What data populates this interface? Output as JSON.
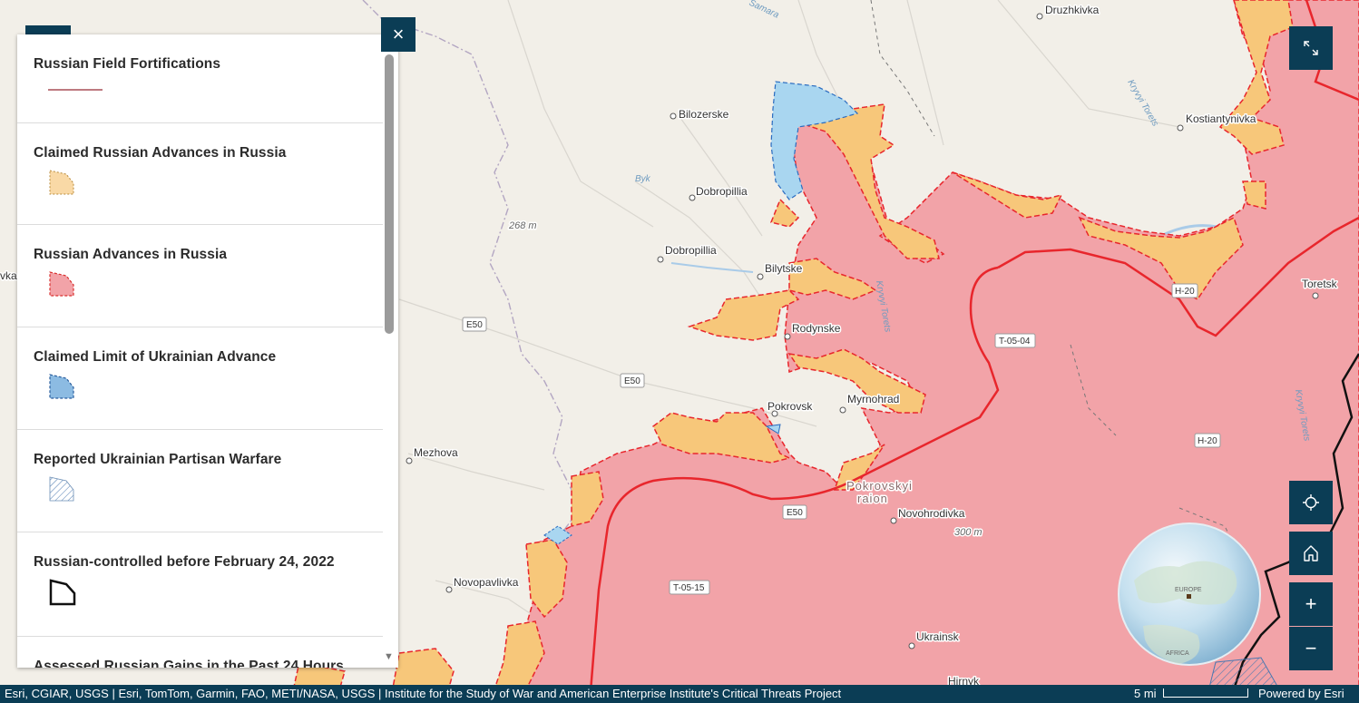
{
  "legend": {
    "close_label": "×",
    "items": [
      {
        "title": "Russian Field Fortifications",
        "swatch": "line-icon"
      },
      {
        "title": "Claimed Russian Advances in Russia",
        "swatch": "orange-dotted-polygon-icon"
      },
      {
        "title": "Russian Advances in Russia",
        "swatch": "red-dashed-polygon-icon"
      },
      {
        "title": "Claimed Limit of Ukrainian Advance",
        "swatch": "blue-dashed-polygon-icon"
      },
      {
        "title": "Reported Ukrainian Partisan Warfare",
        "swatch": "hatched-polygon-icon"
      },
      {
        "title": "Russian-controlled before February 24, 2022",
        "swatch": "black-outline-polygon-icon"
      },
      {
        "title": "Assessed Russian Gains in the Past 24 Hours",
        "swatch": ""
      }
    ]
  },
  "map": {
    "places": [
      "Druzhkivka",
      "Bilozerske",
      "Kostiantynivka",
      "Dobropillia",
      "Dobropillia",
      "Bilytske",
      "Rodynske",
      "Pokrovsk",
      "Myrnohrad",
      "Mezhova",
      "Novopavlivka",
      "Novohrodivka",
      "Ukrainsk",
      "Toretsk",
      "Hirnyk",
      "vka"
    ],
    "district_label": [
      "Pokrovskyi",
      "raion"
    ],
    "elevations": [
      "268 m",
      "300 m"
    ],
    "rivers": [
      "Byk",
      "Kryvyi Torets",
      "Kryvyi Torets",
      "Kryvyi Torets",
      "Samara"
    ],
    "roads": [
      "E50",
      "E50",
      "E50",
      "T-05-04",
      "H-20",
      "H-20",
      "T-05-15"
    ],
    "globe_labels": [
      "EUROPE",
      "AFRICA"
    ],
    "colors": {
      "russian_advance": "#f2a3a8",
      "claimed_advance": "#f7c77a",
      "ukrainian_limit": "#a9d6f0",
      "frontline": "#e8262c",
      "ui_dark": "#0b3d55"
    }
  },
  "tools": {
    "fullscreen": "fullscreen-icon",
    "locate": "locate-icon",
    "home": "home-icon",
    "zoom_in": "+",
    "zoom_out": "−"
  },
  "footer": {
    "attribution": "Esri, CGIAR, USGS | Esri, TomTom, Garmin, FAO, METI/NASA, USGS | Institute for the Study of War and American Enterprise Institute's Critical Threats Project",
    "scale": "5 mi",
    "powered": "Powered by Esri"
  }
}
